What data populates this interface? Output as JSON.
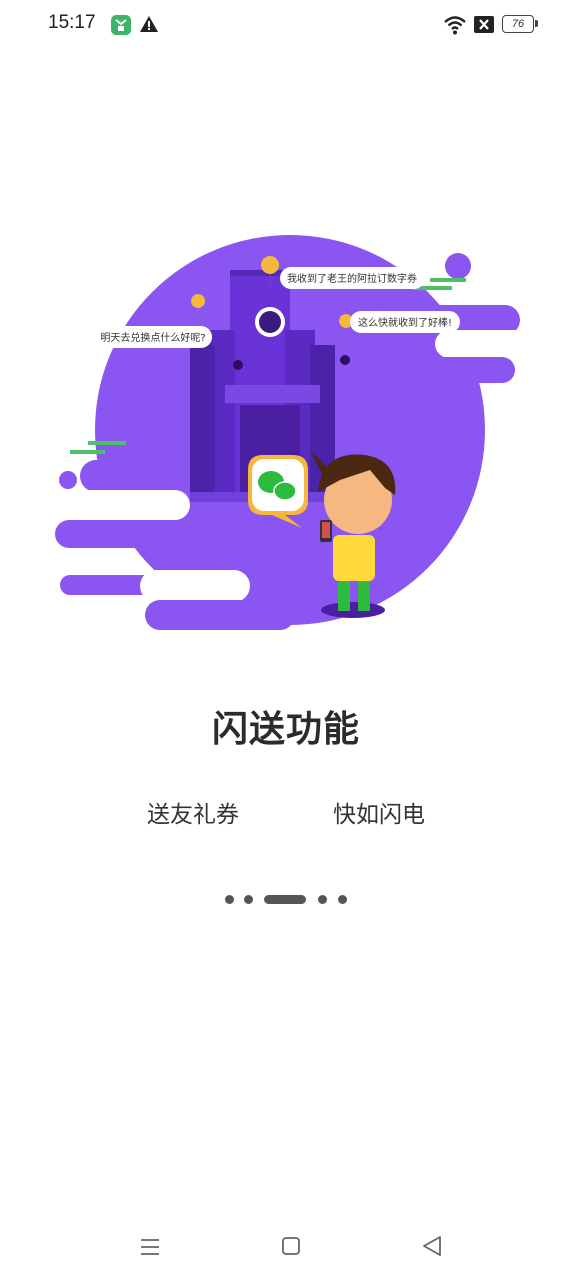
{
  "status_bar": {
    "time": "15:17",
    "battery": "76"
  },
  "illustration": {
    "bubble_top": "我收到了老王的阿拉订数字券",
    "bubble_left": "明天去兑换点什么好呢?",
    "bubble_right": "这么快就收到了好棒!",
    "accent_color": "#8a55f0"
  },
  "main": {
    "title": "闪送功能",
    "subtitle_left": "送友礼券",
    "subtitle_right": "快如闪电"
  },
  "pager": {
    "count": 5,
    "active_index": 2
  }
}
